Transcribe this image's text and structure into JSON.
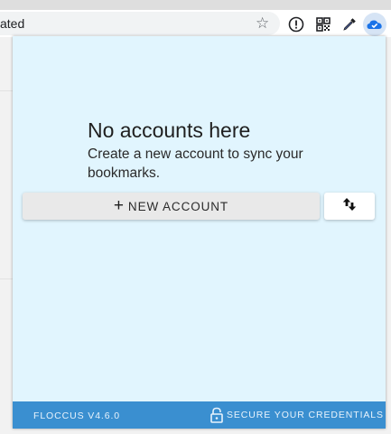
{
  "browser": {
    "address_text": "ated",
    "bookmark_icon": "star-icon",
    "extensions": [
      "info-icon",
      "qr-code-icon",
      "color-picker-icon",
      "floccus-cloud-icon"
    ]
  },
  "popup": {
    "empty_state": {
      "title": "No accounts here",
      "description": "Create a new account to sync your bookmarks."
    },
    "new_account_button": {
      "icon": "plus-icon",
      "label": "NEW ACCOUNT"
    },
    "import_export_button": {
      "icon": "swap-vertical-icon"
    },
    "footer": {
      "version": "FLOCCUS V4.6.0",
      "secure_label": "SECURE YOUR CREDENTIALS",
      "secure_icon": "lock-open-icon"
    },
    "colors": {
      "background": "#e1f5fe",
      "footer": "#3a8fd0",
      "button": "#e9e9e9"
    }
  }
}
